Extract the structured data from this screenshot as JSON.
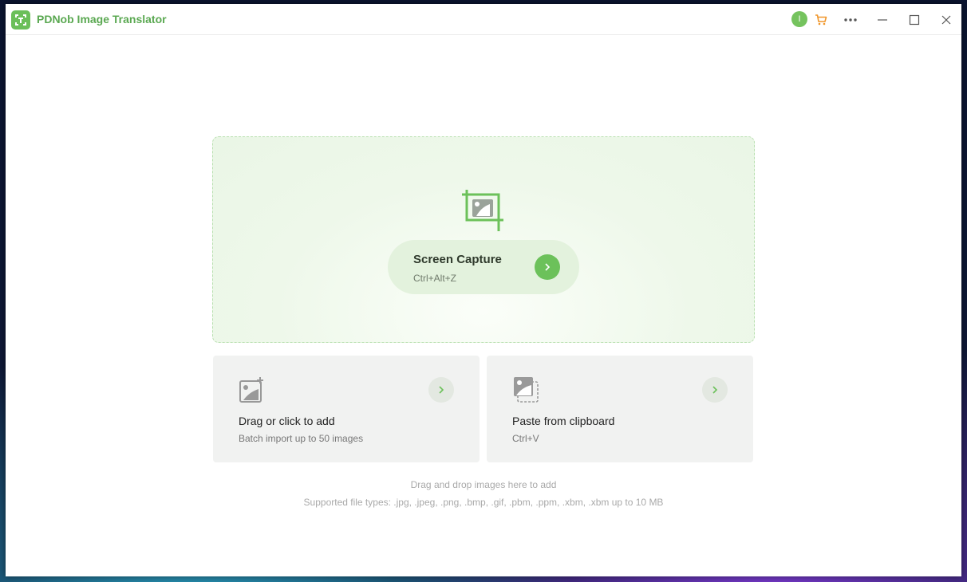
{
  "app": {
    "title": "PDNob Image Translator",
    "avatar_letter": "I",
    "accent_color": "#6bbf59",
    "cart_color": "#f0962a",
    "icons": [
      "app-logo-icon",
      "avatar",
      "cart-icon",
      "more-icon",
      "minimize-icon",
      "maximize-icon",
      "close-icon"
    ]
  },
  "capture": {
    "title": "Screen Capture",
    "shortcut": "Ctrl+Alt+Z",
    "icon": "crop-image-icon"
  },
  "cards": [
    {
      "title": "Drag or click to add",
      "subtitle": "Batch import up to 50 images",
      "icon": "add-image-icon"
    },
    {
      "title": "Paste from clipboard",
      "subtitle": "Ctrl+V",
      "icon": "clipboard-image-icon"
    }
  ],
  "hints": {
    "drag_drop": "Drag and drop images here to add",
    "supported": "Supported file types: .jpg, .jpeg, .png, .bmp, .gif, .pbm, .ppm, .xbm, .xbm up to 10 MB"
  }
}
